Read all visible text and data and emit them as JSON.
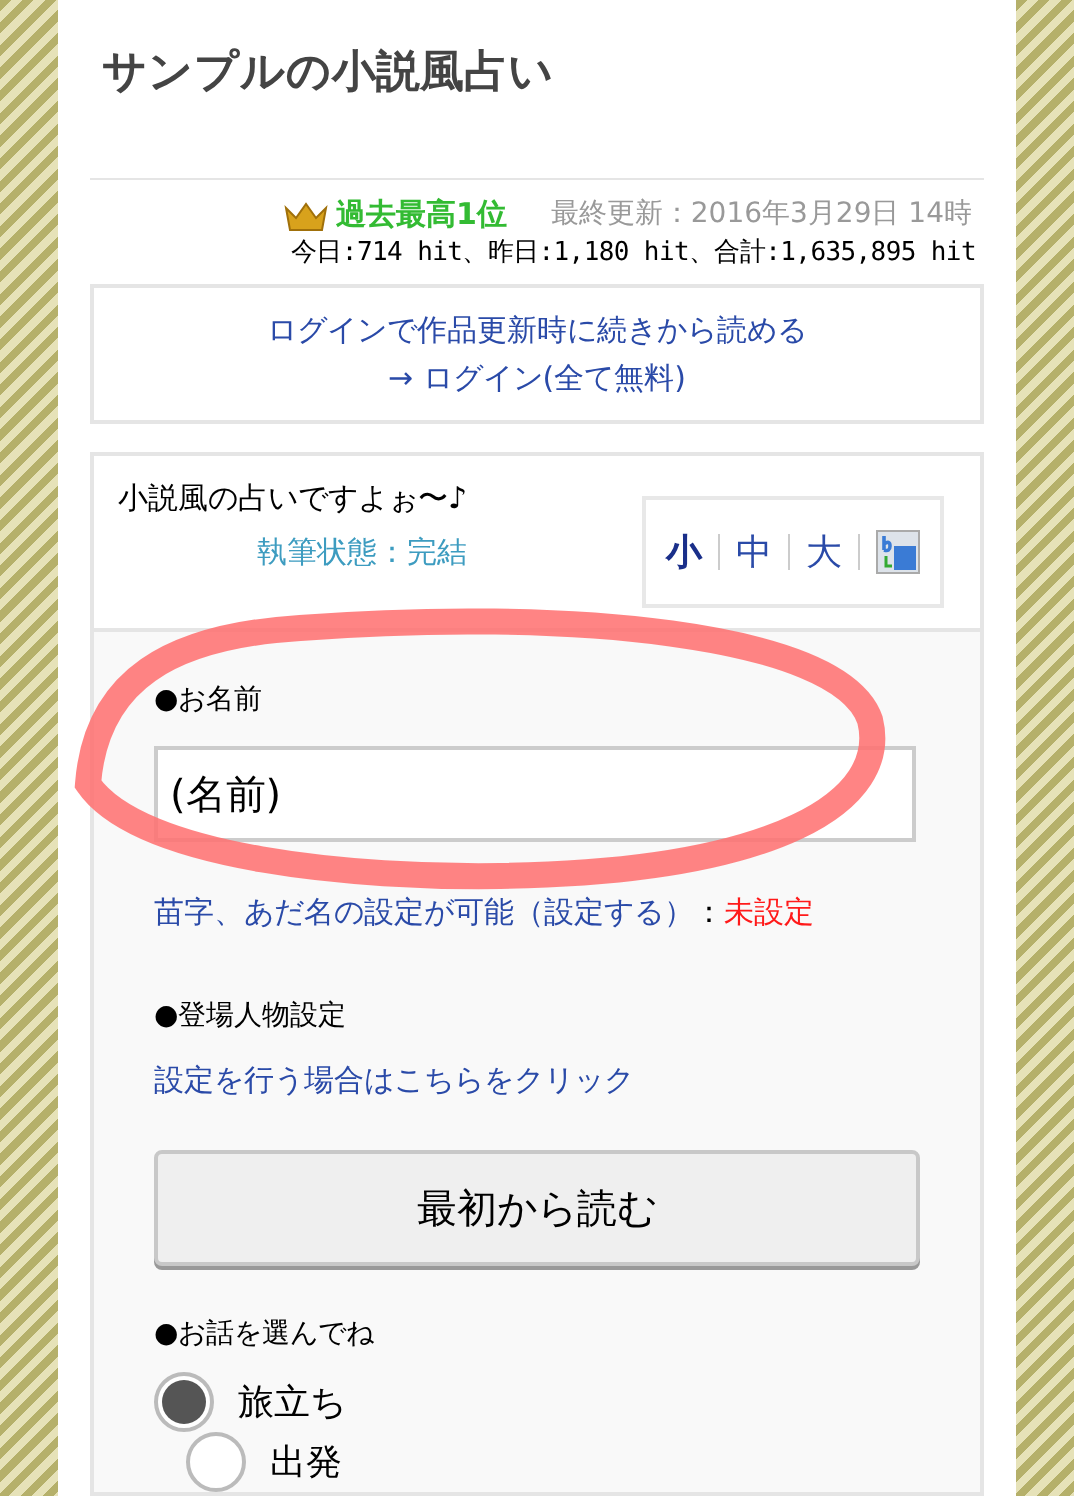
{
  "title": "サンプルの小説風占い",
  "rank": "過去最高1位",
  "updated": "最終更新：2016年3月29日 14時",
  "hits": "今日:714 hit、昨日:1,180 hit、合計:1,635,895 hit",
  "login": {
    "line1": "ログインで作品更新時に続きから読める",
    "line2": "→ ログイン(全て無料)"
  },
  "intro": "小説風の占いですよぉ〜♪",
  "status": "執筆状態：完結",
  "font_sizes": [
    {
      "label": "小",
      "selected": true
    },
    {
      "label": "中",
      "selected": false
    },
    {
      "label": "大",
      "selected": false
    }
  ],
  "name_section": {
    "label": "●お名前",
    "value": "(名前)",
    "note_link": "苗字、あだ名の設定が可能（設定する）",
    "note_sep": "：",
    "note_status": "未設定"
  },
  "character_section": {
    "label": "●登場人物設定",
    "link": "設定を行う場合はこちらをクリック"
  },
  "read_button": "最初から読む",
  "story_section": {
    "label": "●お話を選んでね",
    "options": [
      {
        "label": "旅立ち",
        "selected": true
      },
      {
        "label": "出発",
        "selected": false
      }
    ]
  }
}
